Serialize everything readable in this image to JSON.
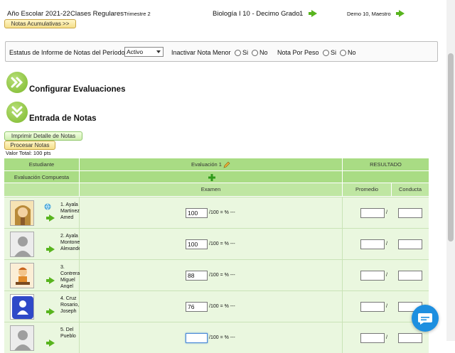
{
  "topbar": {
    "school_year": "Año Escolar 2021-22",
    "class_type": "Clases Regulares",
    "term": "Trimestre 2",
    "course": "Biología I 10 -  Decimo Grado",
    "course_number": "1",
    "user": "Demo 10, Maestro",
    "cumulative_button": "Notas Acumulativas >>"
  },
  "filters": {
    "status_label": "Estatus de Informe de Notas del Período",
    "status_value": "Activo",
    "inactivate_label": "Inactivar Nota Menor",
    "weight_label": "Nota Por Peso",
    "yes": "Si",
    "no": "No"
  },
  "sections": {
    "configure": "Configurar Evaluaciones",
    "entry": "Entrada de Notas"
  },
  "actions": {
    "print": "Imprimir Detalle de Notas",
    "process": "Procesar Notas",
    "total_value": "Valor Total:  100 pts"
  },
  "table": {
    "student_header": "Estudiante",
    "composite_header": "Evaluación Compuesta",
    "evaluation_header": "Evaluación 1",
    "result_header": "RESULTADO",
    "exam_header": "Examen",
    "average_header": "Promedio",
    "conduct_header": "Conducta",
    "score_suffix": "/100 = % ---",
    "slash": "/",
    "rows": [
      {
        "name": "1. Ayala Martinez, Amed",
        "score": "100"
      },
      {
        "name": "2. Ayala Montonez, Alexander",
        "score": "100"
      },
      {
        "name": "3. Contreras, Miguel Angel",
        "score": "88"
      },
      {
        "name": "4. Cruz Rosario, Joseph",
        "score": "76"
      },
      {
        "name": "5. Del Pueblo",
        "score": ""
      }
    ]
  },
  "colors": {
    "header_green": "#a9dc84",
    "row_green": "#eaf7df",
    "accent_green": "#58b41e",
    "chat_blue": "#1d8fe0"
  }
}
